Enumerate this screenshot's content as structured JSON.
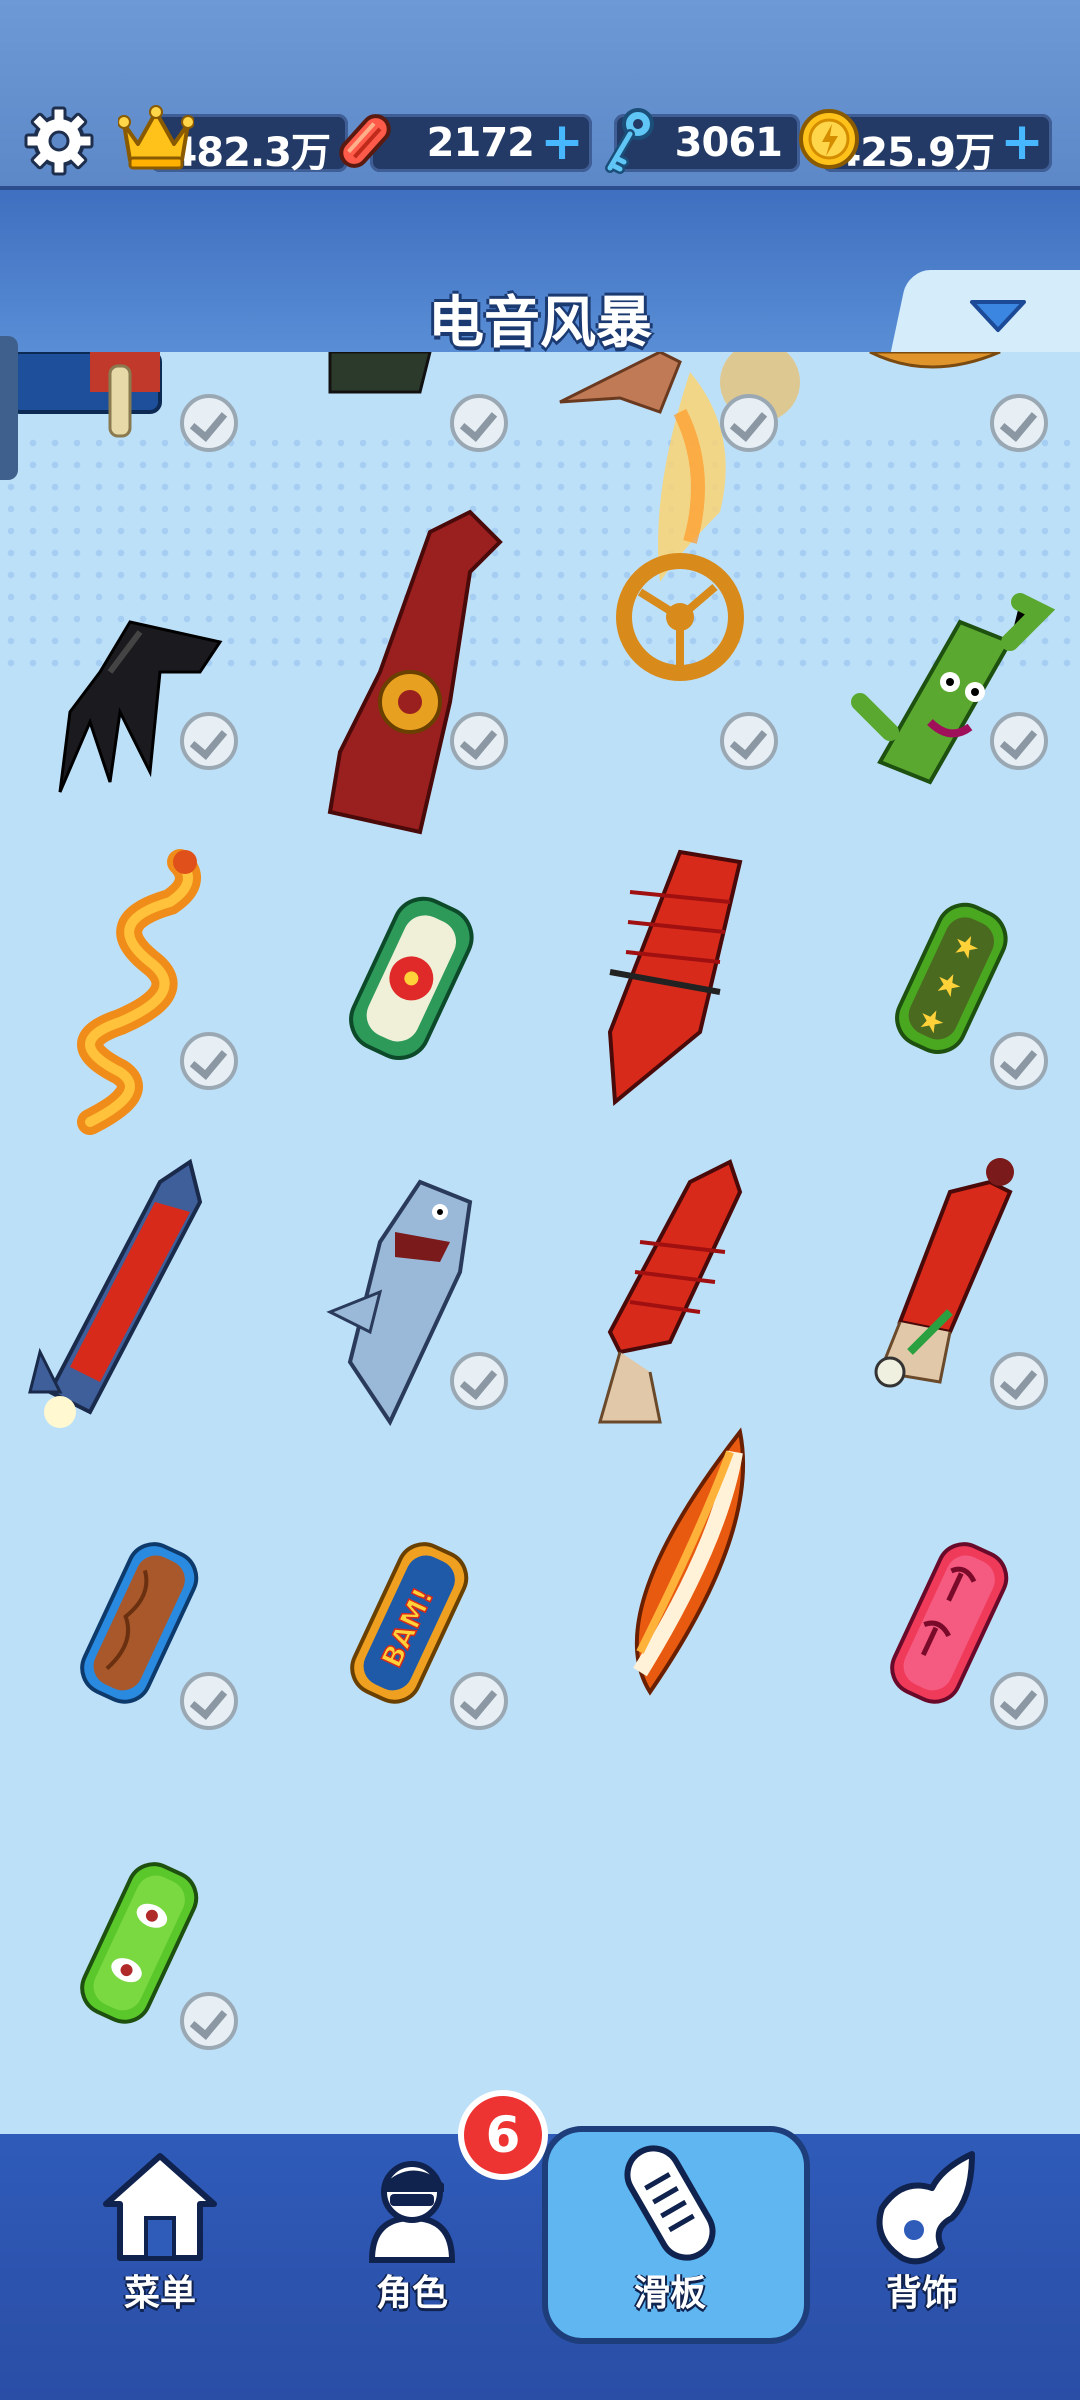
{
  "resources": {
    "trophy_value": "482.3万",
    "boards_value": "2172",
    "keys_value": "3061",
    "coins_value": "425.9万"
  },
  "header": {
    "title": "电音风暴"
  },
  "items": [
    {
      "name": "item-r1c1",
      "owned": true
    },
    {
      "name": "item-r1c2",
      "owned": true
    },
    {
      "name": "item-r1c3",
      "owned": true
    },
    {
      "name": "item-r1c4",
      "owned": true
    },
    {
      "name": "black-claw-board",
      "owned": true
    },
    {
      "name": "red-wolf-board",
      "owned": true
    },
    {
      "name": "golden-ring-fire-board",
      "owned": true
    },
    {
      "name": "cactus-board",
      "owned": true
    },
    {
      "name": "dragon-board",
      "owned": true
    },
    {
      "name": "flower-board",
      "owned": false
    },
    {
      "name": "red-glider-board",
      "owned": false
    },
    {
      "name": "green-stars-board",
      "owned": true
    },
    {
      "name": "rocket-board",
      "owned": false
    },
    {
      "name": "shark-board",
      "owned": true
    },
    {
      "name": "red-plane-board",
      "owned": false
    },
    {
      "name": "fire-extinguisher-board",
      "owned": true
    },
    {
      "name": "wood-board",
      "owned": true
    },
    {
      "name": "bam-board",
      "owned": true
    },
    {
      "name": "surfboard",
      "owned": false
    },
    {
      "name": "pink-palm-board",
      "owned": true
    },
    {
      "name": "green-eyes-board",
      "owned": true
    }
  ],
  "nav": {
    "menu_label": "菜单",
    "character_label": "角色",
    "board_label": "滑板",
    "accessory_label": "背饰",
    "character_badge": "6",
    "active": "board"
  },
  "colors": {
    "accent": "#47b8ff",
    "nav_bg": "#2f5bb9",
    "badge": "#e33333"
  }
}
